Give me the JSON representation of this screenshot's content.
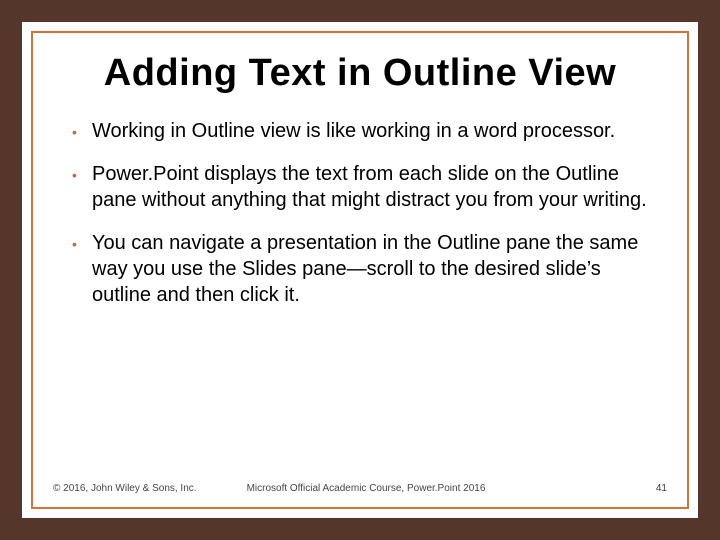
{
  "title": "Adding Text in Outline View",
  "bullets": [
    "Working in Outline view is like working in a word processor.",
    "Power.Point displays the text from each slide on the Outline pane without anything that might distract you from your writing.",
    "You can navigate a presentation in the Outline pane the same way you use the Slides pane—scroll to the desired slide’s outline and then click it."
  ],
  "footer": {
    "copyright": "© 2016, John Wiley & Sons, Inc.",
    "center": "Microsoft Official Academic Course, Power.Point 2016",
    "page_number": "41"
  },
  "colors": {
    "frame": "#55362a",
    "inner_border": "#d2733a",
    "bullet": "#c36a36"
  }
}
